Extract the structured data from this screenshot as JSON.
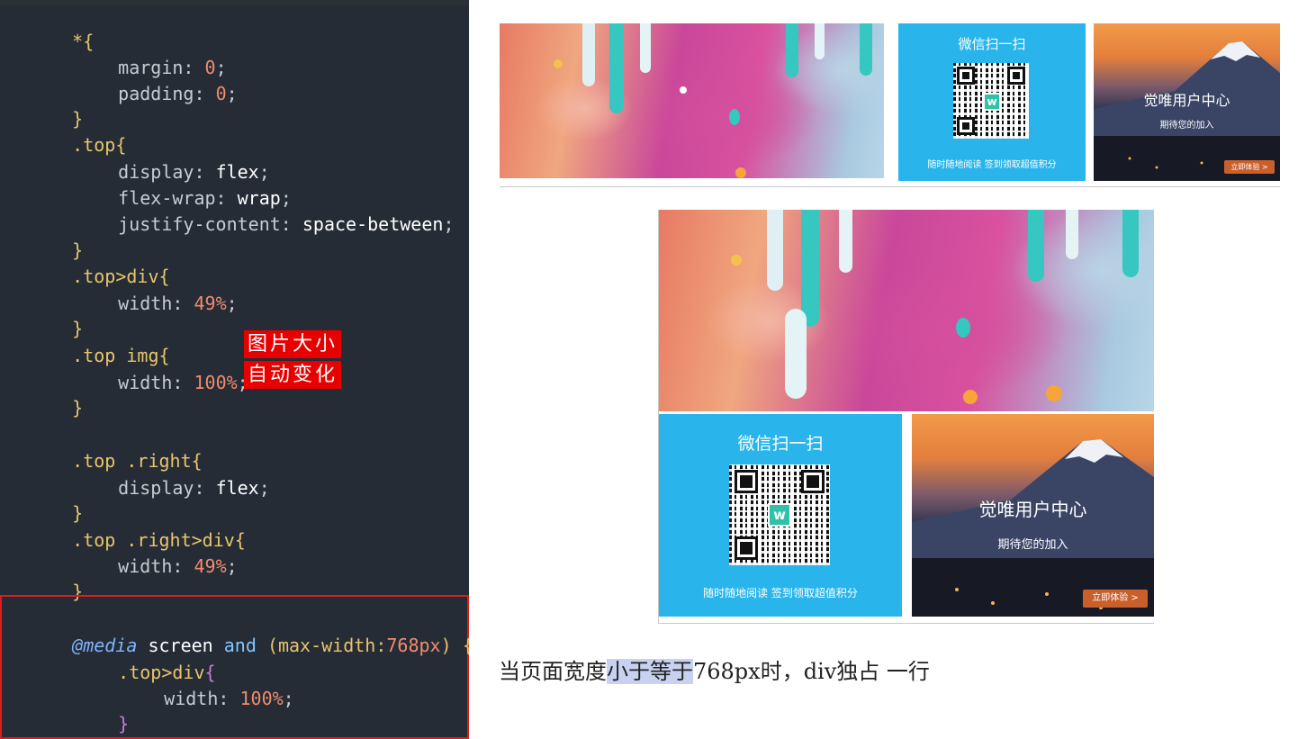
{
  "code": {
    "lines": [
      {
        "selector": "*",
        "open": "{"
      },
      {
        "prop": "margin",
        "value": "0"
      },
      {
        "prop": "padding",
        "value": "0"
      },
      {
        "close": "}"
      },
      {
        "selector": ".top",
        "open": "{"
      },
      {
        "prop": "display",
        "value": "flex"
      },
      {
        "prop": "flex-wrap",
        "value": "wrap"
      },
      {
        "prop": "justify-content",
        "value": "space-between"
      },
      {
        "close": "}"
      },
      {
        "selector": ".top>div",
        "open": "{"
      },
      {
        "prop": "width",
        "value": "49%"
      },
      {
        "close": "}"
      },
      {
        "selector": ".top img",
        "open": "{"
      },
      {
        "prop": "width",
        "value": "100%"
      },
      {
        "close": "}"
      },
      {
        "selector": ".top .right",
        "open": "{"
      },
      {
        "prop": "display",
        "value": "flex"
      },
      {
        "close": "}"
      },
      {
        "selector": ".top .right>div",
        "open": "{"
      },
      {
        "prop": "width",
        "value": "49%"
      },
      {
        "close": "}"
      }
    ],
    "media": {
      "at": "@media",
      "screen": "screen",
      "and": "and",
      "query_open": "(max-width:",
      "query_value": "768px",
      "query_close": ")",
      "open": "{",
      "inner_selector": ".top>div",
      "inner_open": "{",
      "inner_prop": "width",
      "inner_value": "100%",
      "inner_close": "}",
      "close": "}"
    },
    "note_line1": "图片大小",
    "note_line2": "自动变化"
  },
  "preview": {
    "wechat_title": "微信扫一扫",
    "wechat_footer": "随时随地阅读  签到领取超值积分",
    "qr_logo": "w",
    "user_center_title": "觉唯用户中心",
    "user_center_sub": "期待您的加入",
    "user_center_button": "立即体验 >"
  },
  "caption": {
    "before": "当页面宽度",
    "highlight": "小于等于",
    "after": "768px时，div独占 一行"
  },
  "colors": {
    "editor_bg": "#252c36",
    "note_red": "#e80000",
    "wechat_blue": "#29b5ec",
    "button_orange": "#c9602c"
  }
}
